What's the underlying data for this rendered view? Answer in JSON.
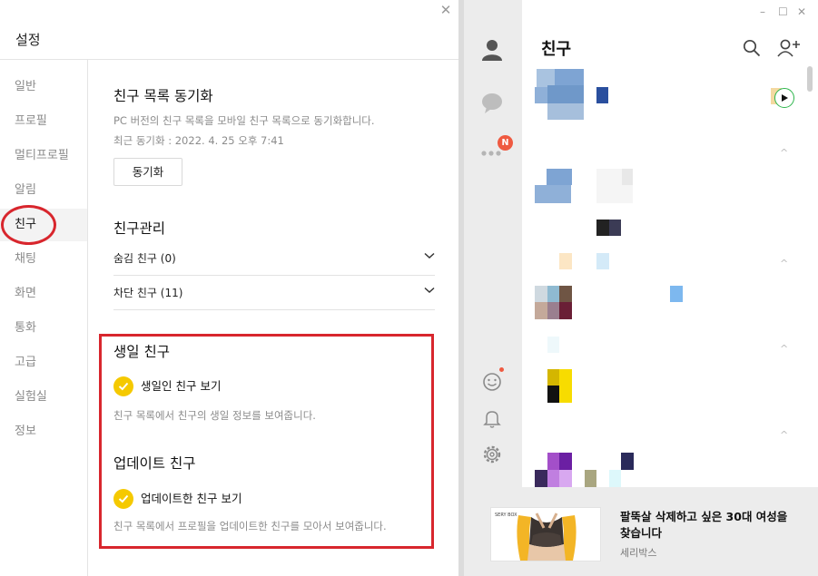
{
  "settings": {
    "title": "설정",
    "close_icon": "close-icon",
    "sidebar": [
      {
        "label": "일반",
        "active": false
      },
      {
        "label": "프로필",
        "active": false
      },
      {
        "label": "멀티프로필",
        "active": false
      },
      {
        "label": "알림",
        "active": false
      },
      {
        "label": "친구",
        "active": true
      },
      {
        "label": "채팅",
        "active": false
      },
      {
        "label": "화면",
        "active": false
      },
      {
        "label": "통화",
        "active": false
      },
      {
        "label": "고급",
        "active": false
      },
      {
        "label": "실험실",
        "active": false
      },
      {
        "label": "정보",
        "active": false
      }
    ],
    "sync": {
      "heading": "친구 목록 동기화",
      "desc": "PC 버전의 친구 목록을 모바일 친구 목록으로 동기화합니다.",
      "last_sync": "최근 동기화 : 2022. 4. 25 오후 7:41",
      "button": "동기화"
    },
    "manage": {
      "heading": "친구관리",
      "hidden": "숨김 친구 (0)",
      "blocked": "차단 친구 (11)"
    },
    "birthday": {
      "heading": "생일 친구",
      "option": "생일인 친구 보기",
      "desc": "친구 목록에서 친구의 생일 정보를 보여줍니다."
    },
    "updated": {
      "heading": "업데이트 친구",
      "option": "업데이트한 친구 보기",
      "desc": "친구 목록에서 프로필을 업데이트한 친구를 모아서 보여줍니다."
    }
  },
  "kakao": {
    "title": "친구",
    "badge": "N",
    "window_controls": [
      "minimize-icon",
      "maximize-icon",
      "close-icon"
    ],
    "ad": {
      "brand_logo": "SERY BOX",
      "title": "팔뚝살 삭제하고 싶은 30대 여성을 찾습니다",
      "sub": "세리박스"
    }
  },
  "colors": {
    "highlight_red": "#d8262d",
    "check_yellow": "#f5c900",
    "badge_red": "#ef5a41"
  }
}
